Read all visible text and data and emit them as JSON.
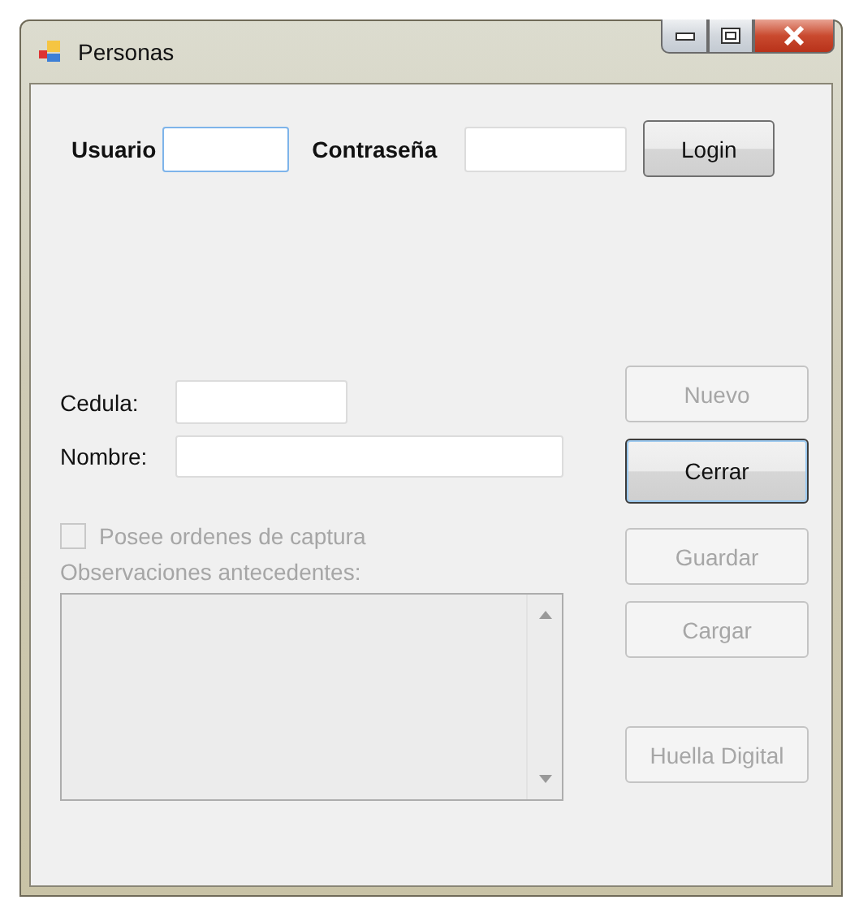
{
  "window": {
    "title": "Personas"
  },
  "login": {
    "user_label": "Usuario",
    "password_label": "Contraseña",
    "button": {
      "label": "Login",
      "disabled": false,
      "default": false
    }
  },
  "fields": [
    {
      "label": "Cedula:",
      "wide": false
    },
    {
      "label": "Nombre:",
      "wide": true
    }
  ],
  "checkbox": {
    "label": "Posee ordenes de captura",
    "checked": false,
    "disabled": true
  },
  "observations": {
    "label": "Observaciones antecedentes:",
    "disabled": true
  },
  "buttons": [
    {
      "label": "Nuevo",
      "disabled": true,
      "default": false
    },
    {
      "label": "Cerrar",
      "disabled": false,
      "default": true
    },
    {
      "label": "Guardar",
      "disabled": true,
      "default": false
    },
    {
      "label": "Cargar",
      "disabled": true,
      "default": false
    },
    {
      "label": "Huella Digital",
      "disabled": true,
      "default": false
    }
  ]
}
